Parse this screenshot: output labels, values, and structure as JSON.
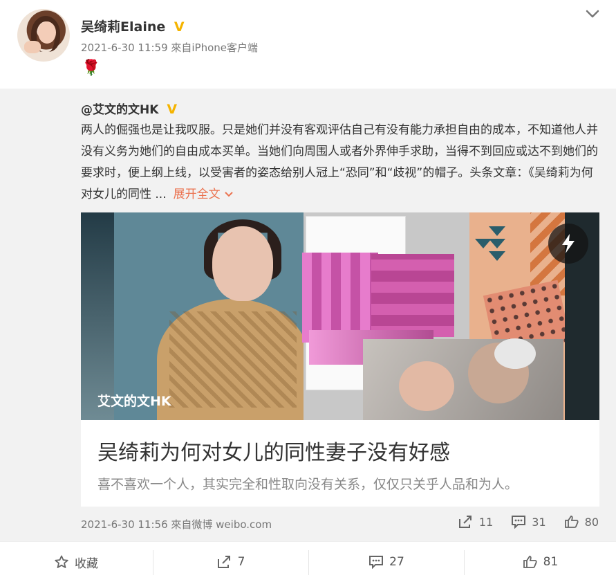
{
  "author": {
    "name": "吴绮莉Elaine",
    "verified_badge": "V",
    "time_source": "2021-6-30 11:59 來自iPhone客户端"
  },
  "post": {
    "emoji": "🌹"
  },
  "retweet": {
    "author": "@艾文的文HK",
    "verified_badge": "V",
    "text": "两人的倔强也是让我叹服。只是她们并没有客观评估自己有没有能力承担自由的成本，不知道他人并没有义务为她们的自由成本买单。当她们向周围人或者外界伸手求助，当得不到回应或达不到她们的要求时，便上纲上线，以受害者的姿态给别人冠上“恐同”和“歧视”的帽子。头条文章：《吴绮莉为何对女儿的同性 ...",
    "expand_label": "展开全文",
    "article": {
      "image_label": "艾文的文HK",
      "title": "吴绮莉为何对女儿的同性妻子没有好感",
      "description": "喜不喜欢一个人，其实完全和性取向没有关系，仅仅只关乎人品和为人。"
    },
    "time_source": "2021-6-30 11:56 來自微博 weibo.com",
    "stats": {
      "reposts": "11",
      "comments": "31",
      "likes": "80"
    }
  },
  "footer": {
    "favorite": "收藏",
    "reposts": "7",
    "comments": "27",
    "likes": "81"
  },
  "colors": {
    "accent_orange": "#eb7350",
    "verified_gold": "#f5b400",
    "retweet_bg": "#f2f2f2"
  },
  "icons": [
    "chevron-down-icon",
    "rose-emoji",
    "flash-icon",
    "repost-icon",
    "comment-icon",
    "like-icon",
    "star-icon"
  ]
}
